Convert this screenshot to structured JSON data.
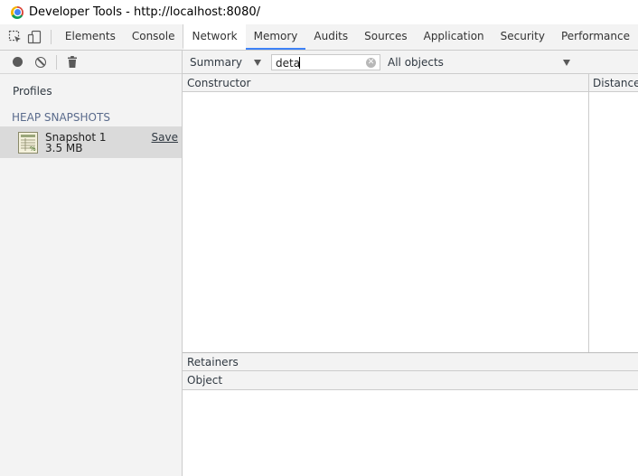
{
  "window": {
    "title": "Developer Tools - http://localhost:8080/"
  },
  "toolbar": {
    "icons": [
      "inspect-element-icon",
      "device-toolbar-icon"
    ],
    "tabs": [
      {
        "label": "Elements"
      },
      {
        "label": "Console"
      },
      {
        "label": "Network"
      },
      {
        "label": "Memory",
        "active": true
      },
      {
        "label": "Audits"
      },
      {
        "label": "Sources"
      },
      {
        "label": "Application"
      },
      {
        "label": "Security"
      },
      {
        "label": "Performance"
      }
    ],
    "active_tab_color": "#3e82f7"
  },
  "sidebar": {
    "toolbar_icons": [
      "record-icon",
      "clear-icon",
      "trash-icon"
    ],
    "profiles_label": "Profiles",
    "section_header": "HEAP SNAPSHOTS",
    "snapshots": [
      {
        "name": "Snapshot 1",
        "size": "3.5 MB",
        "action": "Save",
        "icon": "heap-snapshot-icon"
      }
    ]
  },
  "panel": {
    "view_select": "Summary",
    "filter": {
      "value": "deta"
    },
    "objects_select": "All objects",
    "columns": [
      "Constructor",
      "Distance"
    ],
    "retainers": {
      "title": "Retainers",
      "columns": [
        "Object"
      ]
    }
  }
}
